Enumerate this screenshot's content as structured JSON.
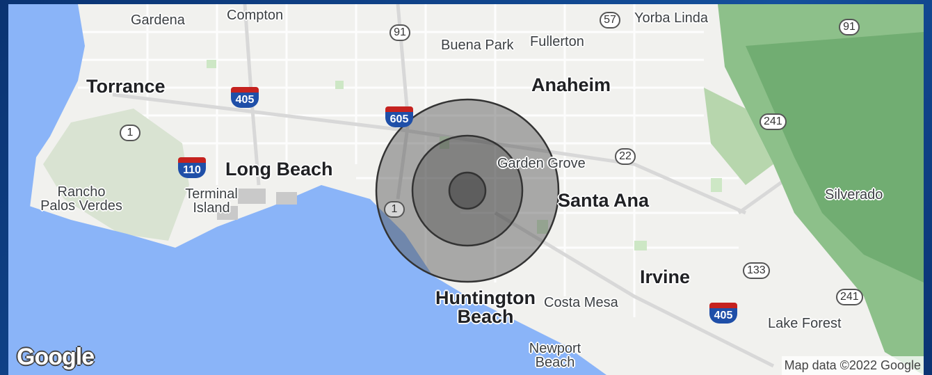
{
  "map": {
    "labels": {
      "gardena": "Gardena",
      "compton": "Compton",
      "yorba_linda": "Yorba Linda",
      "buena_park": "Buena Park",
      "fullerton": "Fullerton",
      "torrance": "Torrance",
      "anaheim": "Anaheim",
      "long_beach": "Long Beach",
      "rancho": "Rancho",
      "palos_verdes": "Palos Verdes",
      "terminal": "Terminal",
      "island": "Island",
      "garden_grove": "Garden Grove",
      "santa_ana": "Santa Ana",
      "silverado": "Silverado",
      "irvine": "Irvine",
      "huntington": "Huntington",
      "beach": "Beach",
      "costa_mesa": "Costa Mesa",
      "lake_forest": "Lake Forest",
      "newport": "Newport",
      "newport_beach": "Beach"
    },
    "shields": {
      "r57": "57",
      "r91a": "91",
      "r91b": "91",
      "r1a": "1",
      "r1b": "1",
      "r22": "22",
      "r241a": "241",
      "r241b": "241",
      "r133": "133"
    },
    "interstates": {
      "i405a": "405",
      "i405b": "405",
      "i605": "605",
      "i110": "110"
    },
    "radius_rings": 3,
    "logo": "Google",
    "attribution": "Map data ©2022 Google"
  }
}
